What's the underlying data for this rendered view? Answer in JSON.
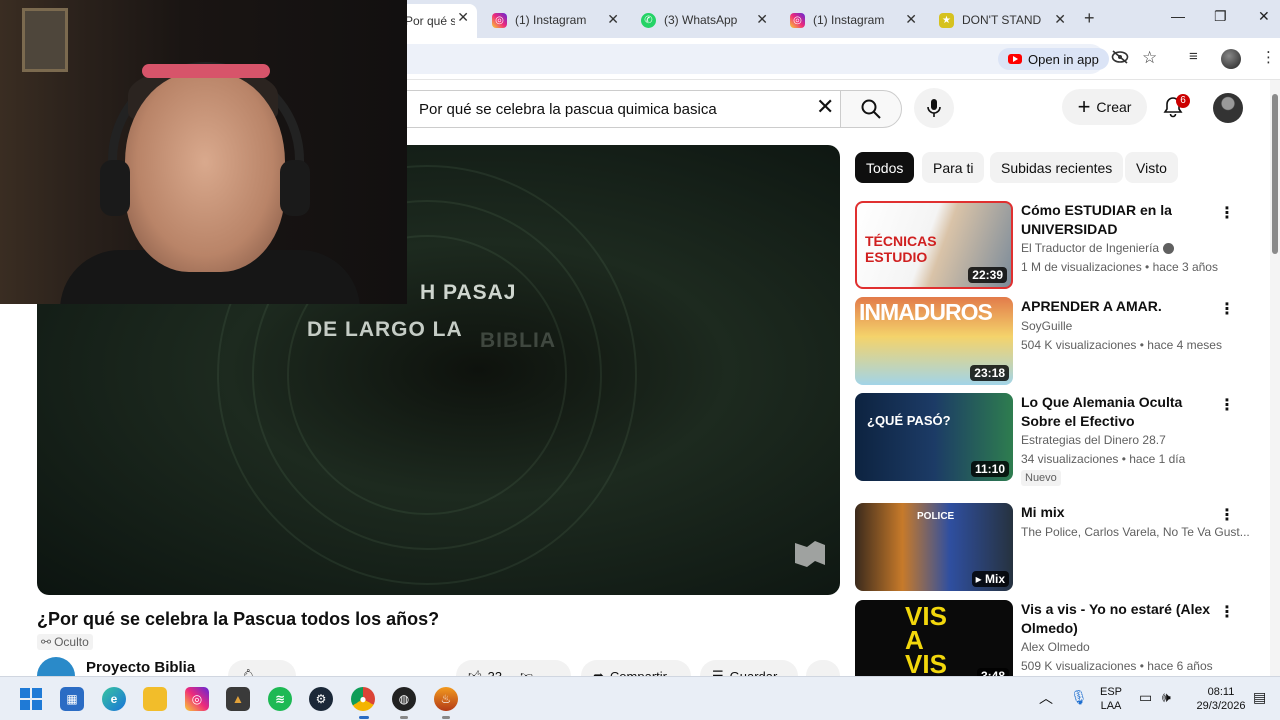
{
  "browser": {
    "tabs": [
      {
        "label": "Por qué se c",
        "icon": "youtube-icon",
        "active": true
      },
      {
        "label": "(1) Instagram",
        "icon": "instagram-icon"
      },
      {
        "label": "(3) WhatsApp",
        "icon": "whatsapp-icon"
      },
      {
        "label": "(1) Instagram",
        "icon": "instagram-icon"
      },
      {
        "label": "DON'T STAND S",
        "icon": "star-icon"
      }
    ],
    "open_in_app": "Open in app"
  },
  "youtube": {
    "search_query": "Por qué se celebra la pascua quimica basica",
    "create_label": "Crear",
    "notification_count": "6",
    "video": {
      "overlay_line1": "H PASAJ",
      "overlay_line2": "DE LARGO LA",
      "overlay_line3": "BIBLIA",
      "title": "¿Por qué se celebra la Pascua todos los años?",
      "visibility": "Oculto",
      "channel": "Proyecto Biblia",
      "like_count": "33",
      "share_label": "Compartir",
      "save_label": "Guardar"
    },
    "chips": [
      "Todos",
      "Para ti",
      "Subidas recientes",
      "Visto"
    ],
    "recommendations": [
      {
        "title": "Cómo ESTUDIAR en la UNIVERSIDAD",
        "channel": "El Traductor de Ingeniería",
        "meta": "1 M de visualizaciones • hace 3 años",
        "duration": "22:39",
        "thumb_text": "TÉCNICAS ESTUDIO"
      },
      {
        "title": "APRENDER A AMAR.",
        "channel": "SoyGuille",
        "meta": "504 K visualizaciones • hace 4 meses",
        "duration": "23:18",
        "thumb_text": "INMADUROS"
      },
      {
        "title": "Lo Que Alemania Oculta Sobre el Efectivo",
        "channel": "Estrategias del Dinero 28.7",
        "meta": "34 visualizaciones • hace 1 día",
        "duration": "11:10",
        "badge": "Nuevo",
        "thumb_text": "¿QUÉ PASÓ?"
      },
      {
        "title": "Mi mix",
        "channel": "The Police, Carlos Varela, No Te Va Gust...",
        "meta": "",
        "duration": "Mix",
        "thumb_text": "POLICE"
      },
      {
        "title": "Vis a vis - Yo no estaré (Alex Olmedo)",
        "channel": "Alex Olmedo",
        "meta": "509 K visualizaciones • hace 6 años",
        "duration": "3:48",
        "thumb_text": "VIS A VIS"
      }
    ]
  },
  "taskbar": {
    "language": "ESP",
    "layout": "LAA",
    "time": "08:11",
    "date": "29/3/2026"
  },
  "colors": {
    "accent_red": "#ff0000",
    "chip_active": "#0f0f0f",
    "tabstrip": "#dfe5f1"
  }
}
